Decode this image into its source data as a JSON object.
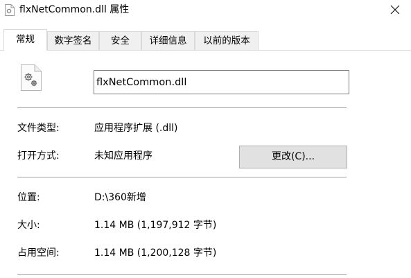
{
  "window": {
    "title": "flxNetCommon.dll 属性",
    "title_icon": "dll-file-icon",
    "close_icon": "close-icon"
  },
  "tabs": [
    {
      "label": "常规",
      "active": true
    },
    {
      "label": "数字签名",
      "active": false
    },
    {
      "label": "安全",
      "active": false
    },
    {
      "label": "详细信息",
      "active": false
    },
    {
      "label": "以前的版本",
      "active": false
    }
  ],
  "general": {
    "file_icon": "dll-settings-file-icon",
    "filename": "flxNetCommon.dll",
    "file_type_label": "文件类型:",
    "file_type_value": "应用程序扩展 (.dll)",
    "opens_with_label": "打开方式:",
    "opens_with_value": "未知应用程序",
    "change_button": "更改(C)...",
    "location_label": "位置:",
    "location_value": "D:\\360新增",
    "size_label": "大小:",
    "size_value": "1.14 MB (1,197,912 字节)",
    "size_on_disk_label": "占用空间:",
    "size_on_disk_value": "1.14 MB (1,200,128 字节)"
  },
  "colors": {
    "tab_border": "#d9d9d9",
    "separator": "#a0a0a0",
    "button_bg": "#e1e1e1",
    "input_border": "#7a7a7a"
  }
}
